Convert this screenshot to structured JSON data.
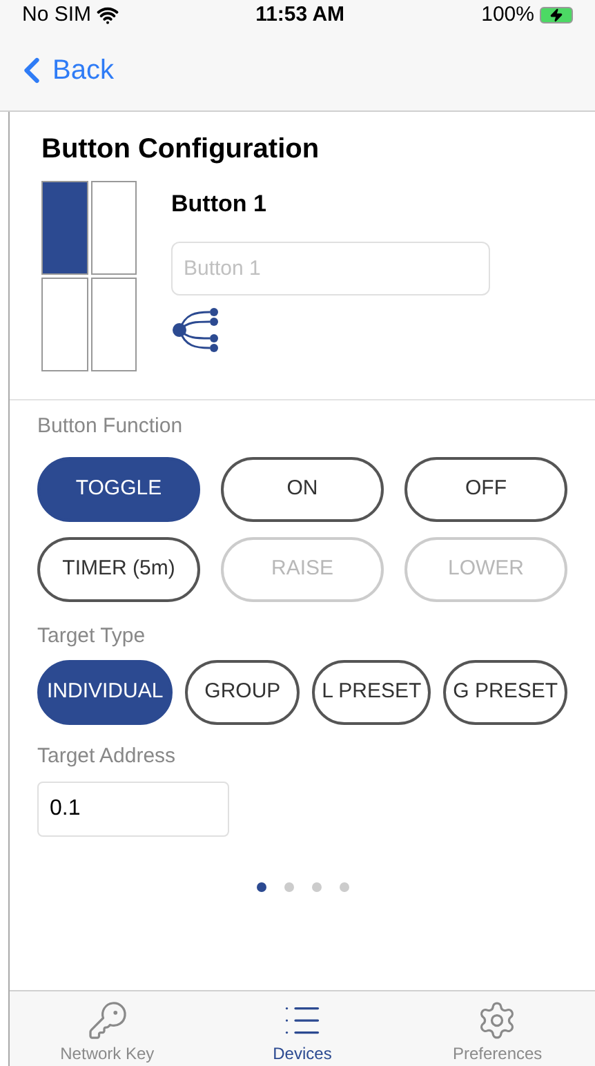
{
  "status_bar": {
    "carrier": "No SIM",
    "time": "11:53 AM",
    "battery": "100%"
  },
  "nav": {
    "back": "Back"
  },
  "title": "Button Configuration",
  "button_grid": [
    {
      "selected": true
    },
    {
      "selected": false
    },
    {
      "selected": false
    },
    {
      "selected": false
    }
  ],
  "button_name": "Button 1",
  "name_field": {
    "placeholder": "Button 1"
  },
  "button_function": {
    "label": "Button Function",
    "options": [
      {
        "label": "TOGGLE",
        "selected": true,
        "disabled": false
      },
      {
        "label": "ON",
        "selected": false,
        "disabled": false
      },
      {
        "label": "OFF",
        "selected": false,
        "disabled": false
      },
      {
        "label": "TIMER (5m)",
        "selected": false,
        "disabled": false
      },
      {
        "label": "RAISE",
        "selected": false,
        "disabled": true
      },
      {
        "label": "LOWER",
        "selected": false,
        "disabled": true
      }
    ]
  },
  "target_type": {
    "label": "Target Type",
    "options": [
      {
        "label": "INDIVIDUAL",
        "selected": true
      },
      {
        "label": "GROUP",
        "selected": false
      },
      {
        "label": "L PRESET",
        "selected": false
      },
      {
        "label": "G PRESET",
        "selected": false
      }
    ]
  },
  "target_address": {
    "label": "Target Address",
    "value": "0.1"
  },
  "page_dots": [
    {
      "selected": true
    },
    {
      "selected": false
    },
    {
      "selected": false
    },
    {
      "selected": false
    }
  ],
  "tabs": [
    {
      "label": "Network Key",
      "selected": false,
      "kind": "key"
    },
    {
      "label": "Devices",
      "selected": true,
      "kind": "list"
    },
    {
      "label": "Preferences",
      "selected": false,
      "kind": "gear"
    }
  ]
}
